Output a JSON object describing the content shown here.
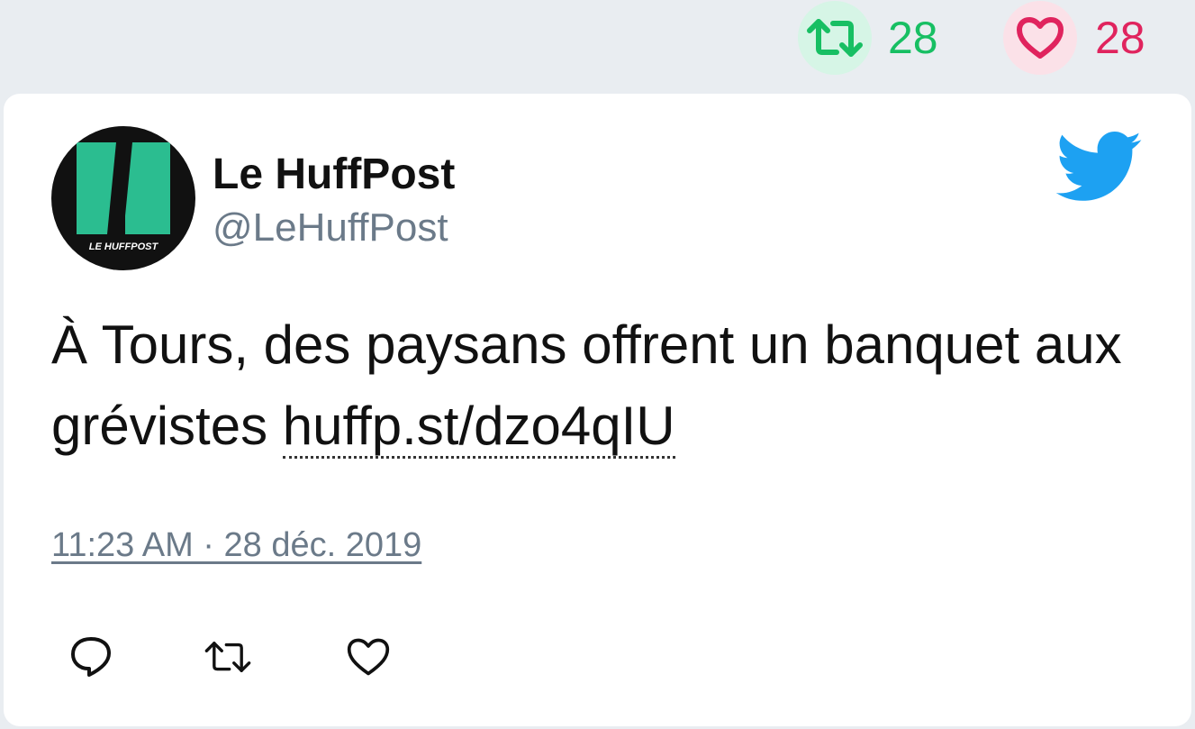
{
  "header_stats": {
    "retweet_count": "28",
    "like_count": "28",
    "retweet_icon": "retweet-icon",
    "like_icon": "heart-icon"
  },
  "tweet": {
    "author_name": "Le HuffPost",
    "author_handle": "@LeHuffPost",
    "avatar_logo_text": "LE HUFFPOST",
    "text": "À Tours, des paysans offrent un banquet aux grévistes ",
    "link_text": "huffp.st/dzo4qIU",
    "timestamp": "11:23 AM · 28 déc. 2019",
    "platform_icon": "twitter-bird-icon"
  },
  "actions": {
    "reply_icon": "reply-icon",
    "retweet_icon": "retweet-icon",
    "like_icon": "heart-icon"
  },
  "colors": {
    "background": "#e9edf1",
    "card": "#ffffff",
    "retweet_green": "#17bf63",
    "like_red": "#e0245e",
    "twitter_blue": "#1da1f2",
    "muted_text": "#6b7a89",
    "huffpost_green": "#2bbd90"
  }
}
